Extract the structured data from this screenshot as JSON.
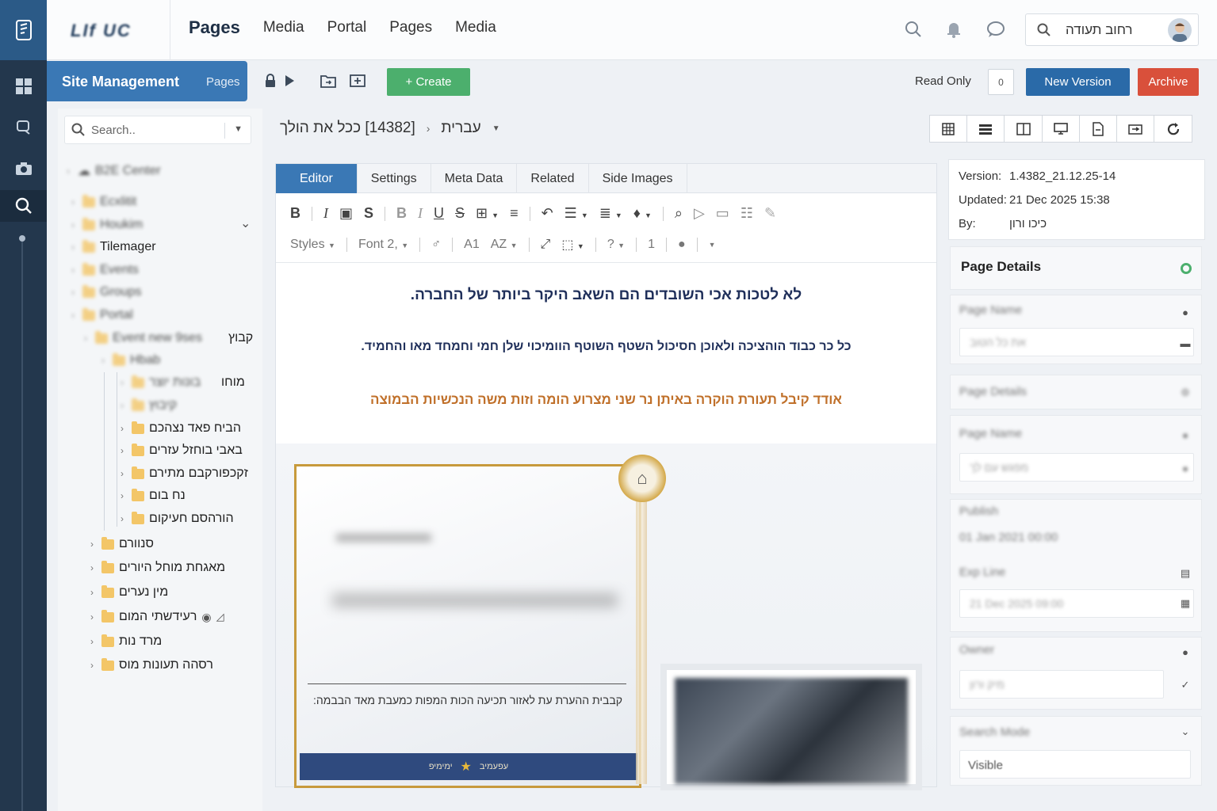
{
  "header": {
    "brand": "LIf  UC",
    "nav": [
      "Pages",
      "Media",
      "Portal",
      "Pages",
      "Media"
    ],
    "user_name": "רחוב תעודה"
  },
  "toolbar": {
    "section_title": "Site Management",
    "section_sub": "Pages",
    "create_label": "+ Create",
    "readonly_label": "Read Only",
    "readonly_toggle": "0",
    "new_version_label": "New Version",
    "archive_label": "Archive"
  },
  "sidebar": {
    "search_placeholder": "Search..",
    "tree": [
      {
        "label": "B2E Center",
        "blurred": true
      },
      {
        "label": "Ecxlitit",
        "blurred": true
      },
      {
        "label": "Houkim",
        "blurred": true
      },
      {
        "label": "Tilemager",
        "blurred": false
      },
      {
        "label": "Events",
        "blurred": true
      },
      {
        "label": "Groups",
        "blurred": true
      },
      {
        "label": "Portal",
        "blurred": true
      },
      {
        "label": "קבוץ",
        "blurred": false
      },
      {
        "label": "Hbab",
        "blurred": true
      },
      {
        "label": "מוחו",
        "blurred": false
      },
      {
        "label": "קיבוץ",
        "blurred": true
      },
      {
        "label": "הביח פאד נצהכם",
        "blurred": false
      },
      {
        "label": "באבי בוחזל עזרים",
        "blurred": false
      },
      {
        "label": "זקכפורקבם מתירם",
        "blurred": false
      },
      {
        "label": "נח בום",
        "blurred": false
      },
      {
        "label": "הורהסם חעיקום",
        "blurred": false
      },
      {
        "label": "סנוורם",
        "blurred": false
      },
      {
        "label": "מאגחת מוחל היורים",
        "blurred": false
      },
      {
        "label": "מין נערים",
        "blurred": false
      },
      {
        "label": "רעידשתי המום",
        "blurred": false
      },
      {
        "label": "מרד נות",
        "blurred": false
      },
      {
        "label": "רסהה תעונות מוס",
        "blurred": false
      }
    ]
  },
  "editor": {
    "page_title": "[14382] ככל את הולך",
    "language": "עברית",
    "tabs": [
      "Editor",
      "Settings",
      "Meta Data",
      "Related",
      "Side Images"
    ],
    "styles_label": "Styles",
    "font_label": "Font",
    "font_size": "2,",
    "para1": "לא לטכות אכי השובדים הם השאב היקר ביותר של החברה.",
    "para2": "כל כר כבוד הוהציכה ולאוכן חסיכול השטף השוטף הוומיכוי שלן חמי וחמחד מאו והחמיד.",
    "para3": "אודד קיבל תעורת הוקרה באיתן נר שני מצרוע הומה וזות משה הנכשיות הבמוצה",
    "cert_text": "קבבית ההערת עת לאזור תכיעה הכות המפות כמעבת מאד הבבמה:",
    "cert_footer_left": "ימימיפ",
    "cert_footer_right": "עפעמיב"
  },
  "info": {
    "version_label": "Version:",
    "version": "1.4382_21.12.25-14",
    "updated_label": "Updated:",
    "updated": "21 Dec 2025 15:38",
    "by_label": "By:",
    "by": "כיכו ורון"
  },
  "details": {
    "title": "Page Details",
    "page_name_label": "Page Name",
    "page_name_value": "את כל הטוב",
    "page_details_label": "Page Details",
    "page_name2_label": "Page Name",
    "page_name2_value": "מפגש עם לך",
    "publish_label": "Publish",
    "publish_value": "01 Jan 2021 00:00",
    "expire_label": "Exp Line",
    "expire_value": "21 Dec 2025 09:00",
    "owner_label": "Owner",
    "owner_value": "מיק ורון",
    "search_mode_label": "Search Mode",
    "search_mode_value": "Visible"
  },
  "colors": {
    "primary": "#3a78b5",
    "create": "#4caf6d",
    "archive": "#d9503b",
    "rail": "#23374d"
  }
}
